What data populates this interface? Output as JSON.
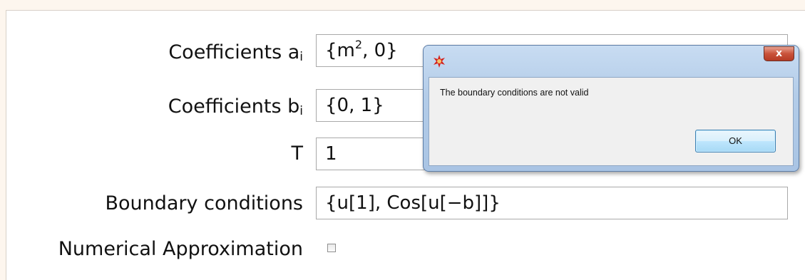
{
  "form": {
    "rows": [
      {
        "label": "Coefficients a",
        "label_sub": "i",
        "value": "{m",
        "value_sup": "2",
        "value_rest": ", 0}"
      },
      {
        "label": "Coefficients b",
        "label_sub": "i",
        "value": "{0, 1}"
      },
      {
        "label": "T",
        "value": "1"
      },
      {
        "label": "Boundary conditions",
        "value": "{u[1], Cos[u[−b]]}"
      },
      {
        "label": "Numerical Approximation",
        "checked": false
      }
    ]
  },
  "dialog": {
    "icon": "app-icon",
    "close_label": "x",
    "message": "The boundary conditions are not valid",
    "ok_label": "OK"
  }
}
